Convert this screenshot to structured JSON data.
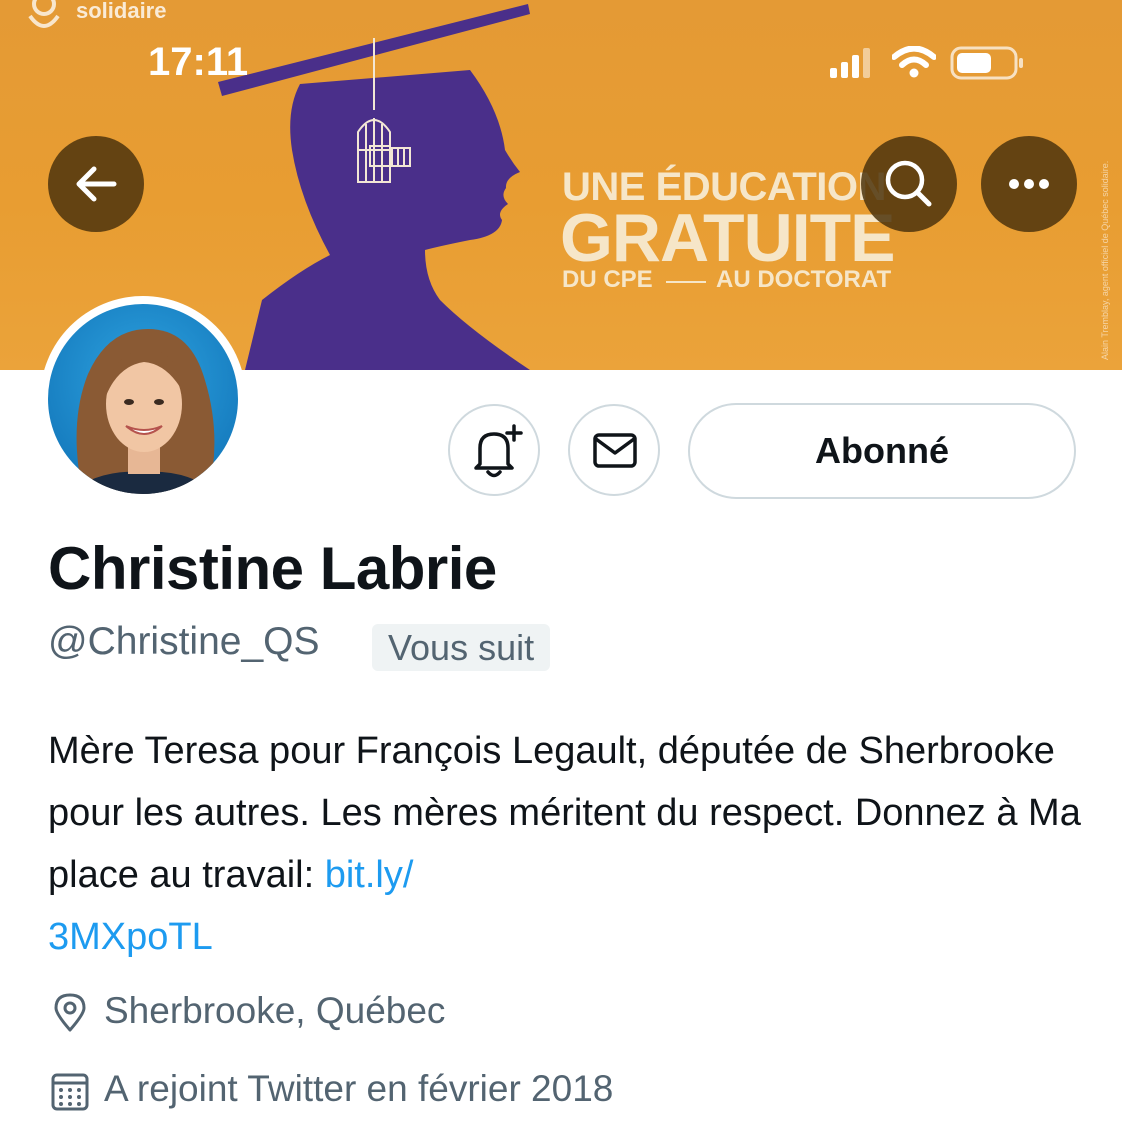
{
  "status_bar": {
    "time": "17:11",
    "icons": [
      "cellular-signal-icon",
      "wifi-icon",
      "battery-icon"
    ]
  },
  "banner": {
    "logo_text": "solidaire",
    "headline_line1": "UNE ÉDUCATION",
    "headline_line2": "GRATUITE",
    "headline_line3_left": "DU CPE",
    "headline_line3_right": "AU DOCTORAT",
    "credit": "Alain Tremblay, agent officiel de Québec solidaire.",
    "background_color": "#e89d32",
    "silhouette_color": "#4a2f8a"
  },
  "header_buttons": {
    "back_icon": "arrow-left-icon",
    "search_icon": "search-icon",
    "more_icon": "more-horizontal-icon"
  },
  "profile": {
    "name": "Christine Labrie",
    "handle": "@Christine_QS",
    "follows_you": "Vous suit",
    "follow_button": "Abonné",
    "bio_text": "Mère Teresa pour François Legault, députée de Sherbrooke pour les autres. Les mères méritent du respect. Donnez à Ma place au travail: ",
    "bio_link": "bit.ly/\n3MXpoTL",
    "location": "Sherbrooke, Québec",
    "joined": "A rejoint Twitter en février 2018"
  },
  "colors": {
    "text_primary": "#0f1419",
    "text_secondary": "#536471",
    "link": "#1d9bf0",
    "border": "#cfd9de"
  }
}
